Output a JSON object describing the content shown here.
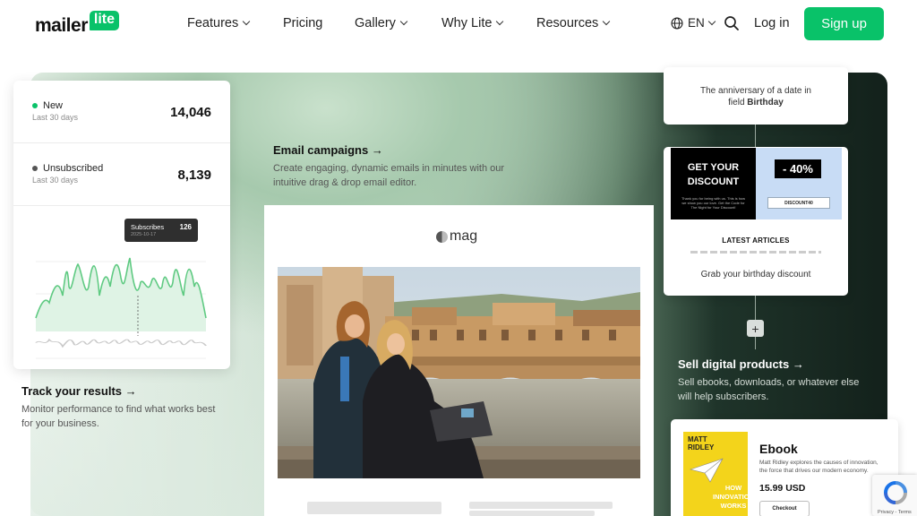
{
  "brand": {
    "logo_word": "mailer",
    "logo_badge": "lite",
    "accent": "#09c269"
  },
  "nav": {
    "items": [
      {
        "label": "Features",
        "dropdown": true
      },
      {
        "label": "Pricing",
        "dropdown": false
      },
      {
        "label": "Gallery",
        "dropdown": true
      },
      {
        "label": "Why Lite",
        "dropdown": true
      },
      {
        "label": "Resources",
        "dropdown": true
      }
    ],
    "language": "EN",
    "login": "Log in",
    "signup": "Sign up"
  },
  "stats": {
    "new": {
      "label": "New",
      "sub": "Last 30 days",
      "value": "14,046",
      "color": "#09c269"
    },
    "unsubscribed": {
      "label": "Unsubscribed",
      "sub": "Last 30 days",
      "value": "8,139",
      "color": "#555555"
    },
    "tooltip": {
      "label": "Subscribes",
      "value": "126",
      "date": "2025-10-17"
    }
  },
  "track": {
    "title": "Track your results →",
    "desc": "Monitor performance to find what works best for your business."
  },
  "email": {
    "title": "Email campaigns →",
    "desc": "Create engaging, dynamic emails in minutes with our intuitive drag & drop email editor.",
    "brand": "mag"
  },
  "automation": {
    "trigger_line1": "The anniversary of a date in",
    "trigger_line2_prefix": "field ",
    "trigger_line2_bold": "Birthday",
    "promo_heading_1": "GET YOUR",
    "promo_heading_2": "DISCOUNT",
    "promo_fine": "Thank you for being with us. This is how we show you our love. Get the Code for The Night for Your Discount!",
    "promo_percent": "- 40%",
    "promo_code": "DISCOUNT40",
    "latest": "LATEST ARTICLES",
    "footer": "Grab your birthday discount",
    "plus": "+"
  },
  "digital": {
    "title": "Sell digital products →",
    "desc": "Sell ebooks, downloads, or whatever else will help subscribers."
  },
  "ebook": {
    "author_1": "MATT",
    "author_2": "RIDLEY",
    "book_1": "HOW",
    "book_2": "INNOVATION",
    "book_3": "WORKS",
    "title": "Ebook",
    "desc": "Matt Ridley explores the causes of innovation, the force that drives our modern economy.",
    "price": "15.99 USD",
    "checkout": "Checkout"
  },
  "recaptcha": {
    "footer": "Privacy - Terms"
  }
}
